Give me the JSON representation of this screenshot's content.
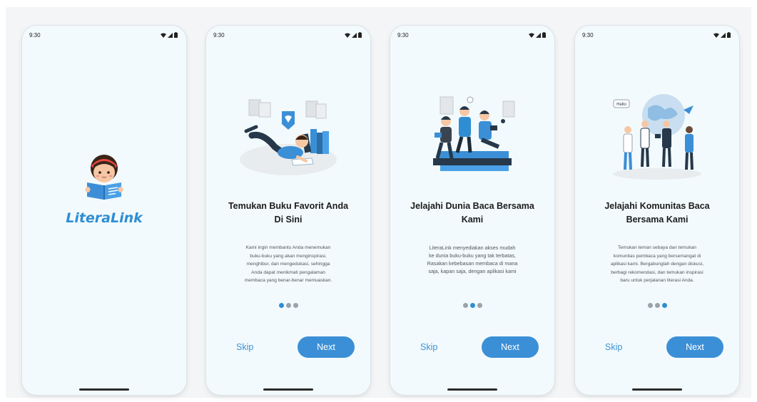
{
  "status_time": "9:30",
  "brand": "LiteraLink",
  "screens": [
    {
      "title_line1": "Temukan Buku Favorit Anda",
      "title_line2": "Di Sini",
      "desc": [
        "Kami ingin membantu Anda menemukan",
        "buku-buku yang akan menginspirasi,",
        "menghibur, dan mengedukasi, sehingga",
        "Anda dapat menikmati pengalaman",
        "membaca yang benar-benar memuaskan."
      ],
      "active_dot": 0
    },
    {
      "title_line1": "Jelajahi Dunia Baca Bersama",
      "title_line2": "Kami",
      "desc": [
        "LiteraLink menyediakan akses mudah",
        "ke dunia buku-buku yang tak terbatas,",
        "Rasakan kebebasan membaca di mana",
        "saja, kapan saja, dengan aplikasi kami"
      ],
      "active_dot": 1
    },
    {
      "title_line1": "Jelajahi Komunitas Baca",
      "title_line2": "Bersama Kami",
      "desc": [
        "Temukan teman sebaya dan temukan",
        "komunitas pembaca yang bersemangat di",
        "aplikasi kami. Bergabunglah dengan diskusi,",
        "berbagi rekomendasi, dan temukan inspirasi",
        "baru untuk perjalanan literasi Anda."
      ],
      "active_dot": 2
    }
  ],
  "skip_label": "Skip",
  "next_label": "Next",
  "illustration_label": "Hello",
  "colors": {
    "accent": "#3b8fd6",
    "bg": "#f2fafd",
    "dot_inactive": "#9aa3a8"
  },
  "icons": [
    "wifi-icon",
    "signal-icon",
    "battery-icon",
    "reading-girl-icon"
  ]
}
